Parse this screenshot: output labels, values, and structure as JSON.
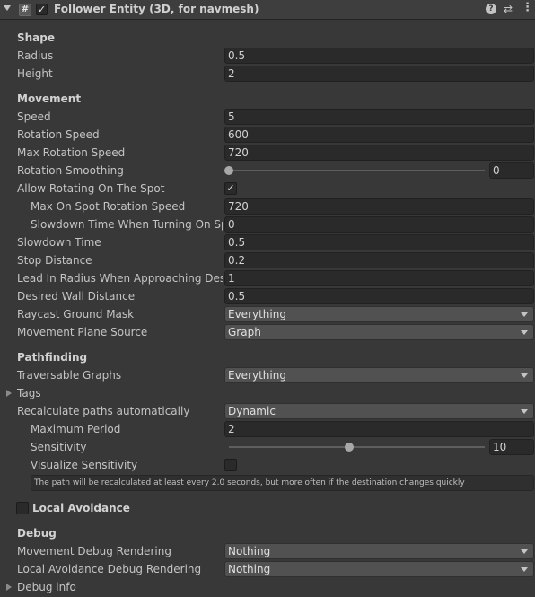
{
  "header": {
    "script_icon": "#",
    "enabled": true,
    "title": "Follower Entity (3D, for navmesh)",
    "help_icon": "?",
    "presets_icon": "⇄",
    "menu_icon": "⋮"
  },
  "shape": {
    "title": "Shape",
    "radius_label": "Radius",
    "radius_value": "0.5",
    "height_label": "Height",
    "height_value": "2"
  },
  "movement": {
    "title": "Movement",
    "speed_label": "Speed",
    "speed_value": "5",
    "rotation_speed_label": "Rotation Speed",
    "rotation_speed_value": "600",
    "max_rotation_speed_label": "Max Rotation Speed",
    "max_rotation_speed_value": "720",
    "rotation_smoothing_label": "Rotation Smoothing",
    "rotation_smoothing_value": "0",
    "rotation_smoothing_level": 0,
    "allow_rotating_label": "Allow Rotating On The Spot",
    "allow_rotating_checked": true,
    "max_on_spot_label": "Max On Spot Rotation Speed",
    "max_on_spot_value": "720",
    "slowdown_turning_label": "Slowdown Time When Turning On Spot",
    "slowdown_turning_value": "0",
    "slowdown_time_label": "Slowdown Time",
    "slowdown_time_value": "0.5",
    "stop_distance_label": "Stop Distance",
    "stop_distance_value": "0.2",
    "lead_in_label": "Lead In Radius When Approaching Destination",
    "lead_in_value": "1",
    "wall_distance_label": "Desired Wall Distance",
    "wall_distance_value": "0.5",
    "raycast_mask_label": "Raycast Ground Mask",
    "raycast_mask_value": "Everything",
    "plane_source_label": "Movement Plane Source",
    "plane_source_value": "Graph"
  },
  "pathfinding": {
    "title": "Pathfinding",
    "traversable_label": "Traversable Graphs",
    "traversable_value": "Everything",
    "tags_label": "Tags",
    "recalc_label": "Recalculate paths automatically",
    "recalc_value": "Dynamic",
    "max_period_label": "Maximum Period",
    "max_period_value": "2",
    "sensitivity_label": "Sensitivity",
    "sensitivity_value": "10",
    "sensitivity_level": 0.47,
    "visualize_label": "Visualize Sensitivity",
    "visualize_checked": false,
    "help_text": "The path will be recalculated at least every 2.0 seconds, but more often if the destination changes quickly"
  },
  "avoidance": {
    "local_avoidance_label": "Local Avoidance",
    "local_avoidance_checked": false
  },
  "debug": {
    "title": "Debug",
    "movement_debug_label": "Movement Debug Rendering",
    "movement_debug_value": "Nothing",
    "avoidance_debug_label": "Local Avoidance Debug Rendering",
    "avoidance_debug_value": "Nothing",
    "debug_info_label": "Debug info"
  }
}
